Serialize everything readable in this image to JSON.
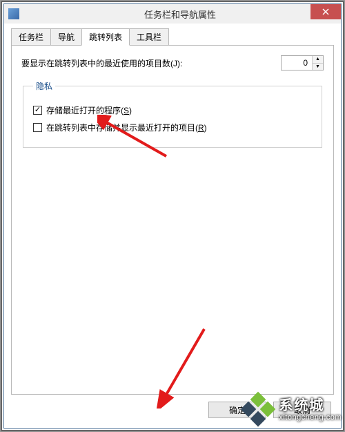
{
  "window": {
    "title": "任务栏和导航属性"
  },
  "tabs": {
    "t1": "任务栏",
    "t2": "导航",
    "t3": "跳转列表",
    "t4": "工具栏"
  },
  "jumplist": {
    "count_label": "要显示在跳转列表中的最近使用的项目数(J):",
    "count_value": "0"
  },
  "privacy": {
    "legend": "隐私",
    "opt1_checked": true,
    "opt1_label_a": "存储最近打开的程序(",
    "opt1_key": "S",
    "opt1_label_b": ")",
    "opt2_checked": false,
    "opt2_label_a": "在跳转列表中存储并显示最近打开的项目(",
    "opt2_key": "R",
    "opt2_label_b": ")"
  },
  "buttons": {
    "ok": "确定",
    "cancel": "取消"
  },
  "watermark": {
    "cn": "系统城",
    "en": "xitongcheng.com"
  }
}
